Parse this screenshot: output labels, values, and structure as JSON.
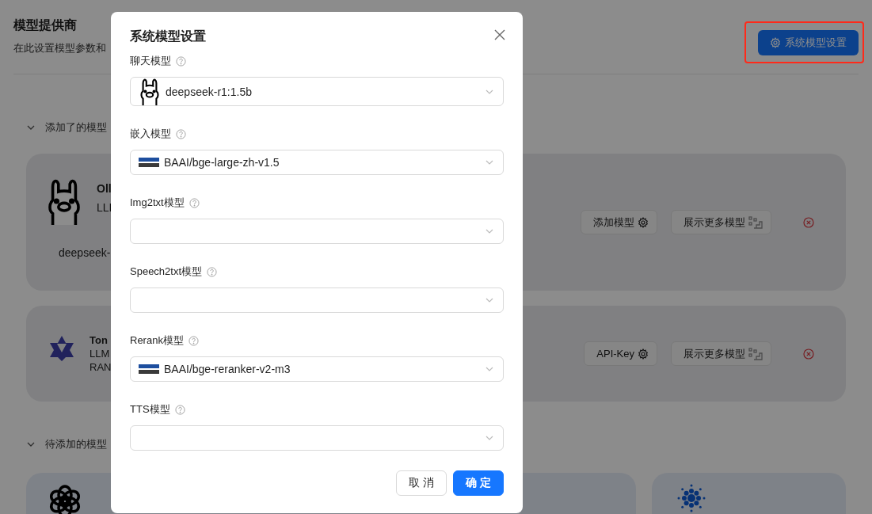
{
  "page": {
    "title": "模型提供商",
    "subtitle": "在此设置模型参数和",
    "settings_button": {
      "label": "系统模型设置",
      "annotated": true
    }
  },
  "added_section": {
    "label": "添加了的模型",
    "expanded": true,
    "providers": [
      {
        "name": "Oll",
        "lines": [
          "LLI"
        ],
        "model": "deepseek-",
        "kind": "llama",
        "buttons": [
          {
            "label": "添加模型",
            "kind": "gear"
          },
          {
            "label": "展示更多模型",
            "kind": "grid"
          }
        ]
      },
      {
        "name": "Ton",
        "lines": [
          "LLM",
          "RAN"
        ],
        "kind": "star",
        "buttons": [
          {
            "label": "API-Key",
            "kind": "gear"
          },
          {
            "label": "展示更多模型",
            "kind": "grid"
          }
        ]
      }
    ]
  },
  "pending_section": {
    "label": "待添加的模型",
    "expanded": true,
    "providers": [
      {
        "kind": "knot"
      },
      {
        "kind": "dots"
      }
    ]
  },
  "dialog": {
    "title": "系统模型设置",
    "fields": [
      {
        "label": "聊天模型",
        "value": "deepseek-r1:1.5b",
        "kind": "llama"
      },
      {
        "label": "嵌入模型",
        "value": "BAAI/bge-large-zh-v1.5",
        "kind": "baai"
      },
      {
        "label": "Img2txt模型"
      },
      {
        "label": "Speech2txt模型"
      },
      {
        "label": "Rerank模型",
        "value": "BAAI/bge-reranker-v2-m3",
        "kind": "baai"
      },
      {
        "label": "TTS模型"
      }
    ],
    "buttons": [
      {
        "label": "取 消",
        "primary": false
      },
      {
        "label": "确 定",
        "primary": true
      }
    ]
  }
}
